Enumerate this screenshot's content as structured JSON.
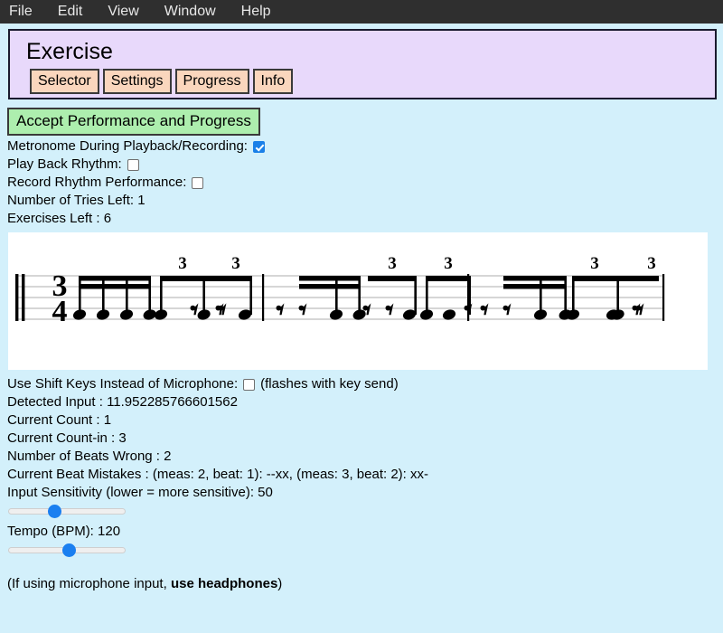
{
  "menubar": {
    "items": [
      {
        "label": "File"
      },
      {
        "label": "Edit"
      },
      {
        "label": "View"
      },
      {
        "label": "Window"
      },
      {
        "label": "Help"
      }
    ]
  },
  "header": {
    "title": "Exercise",
    "tabs": [
      {
        "label": "Selector"
      },
      {
        "label": "Settings"
      },
      {
        "label": "Progress"
      },
      {
        "label": "Info"
      }
    ]
  },
  "actions": {
    "accept_label": "Accept Performance and Progress"
  },
  "options": {
    "metronome_label": "Metronome During Playback/Recording:",
    "metronome_checked": true,
    "playback_label": "Play Back Rhythm:",
    "playback_checked": false,
    "record_label": "Record Rhythm Performance:",
    "record_checked": false,
    "shift_keys_label": "Use Shift Keys Instead of Microphone:",
    "shift_keys_checked": false,
    "shift_keys_hint": "(flashes with key send)"
  },
  "status": {
    "tries_left": "Number of Tries Left: 1",
    "exercises_left": "Exercises Left : 6",
    "detected_input": "Detected Input : 11.952285766601562",
    "current_count": "Current Count : 1",
    "current_count_in": "Current Count-in : 3",
    "beats_wrong": "Number of Beats Wrong : 2",
    "beat_mistakes": "Current Beat Mistakes : (meas: 2, beat: 1): --xx, (meas: 3, beat: 2): xx-"
  },
  "sliders": {
    "sensitivity_label": "Input Sensitivity (lower = more sensitive): 50",
    "sensitivity_value": 38,
    "tempo_label": "Tempo (BPM): 120",
    "tempo_value": 52
  },
  "footnote": {
    "prefix": "(If using microphone input, ",
    "bold": "use headphones",
    "suffix": ")"
  },
  "colors": {
    "page_bg": "#d3f0fb",
    "menubar_bg": "#2f2f2f",
    "header_panel_bg": "#e8d9fb",
    "tab_bg": "#fad6bd",
    "accept_bg": "#adeeae",
    "accent_blue": "#1a7ff0",
    "staff_line": "#c8c8c8",
    "note_black": "#000000"
  },
  "notation": {
    "time_signature": {
      "numerator": "3",
      "denominator": "4"
    },
    "triplet_marks": [
      "3",
      "3",
      "3",
      "3",
      "3",
      "3"
    ],
    "measures": [
      {
        "index": 1,
        "beats": [
          {
            "type": "sixteenth-group",
            "count": 4
          },
          {
            "type": "triplet",
            "notes": [
              "note",
              "note",
              "rest"
            ]
          },
          {
            "type": "triplet",
            "notes": [
              "rest",
              "rest",
              "note"
            ]
          }
        ]
      },
      {
        "index": 2,
        "beats": [
          {
            "type": "sixteenth-group",
            "count": 4,
            "notes": [
              "rest",
              "rest",
              "note",
              "note"
            ]
          },
          {
            "type": "triplet",
            "notes": [
              "rest",
              "rest",
              "note"
            ]
          },
          {
            "type": "triplet",
            "notes": [
              "note",
              "note",
              "rest"
            ]
          }
        ]
      },
      {
        "index": 3,
        "beats": [
          {
            "type": "sixteenth-group",
            "count": 4,
            "notes": [
              "rest",
              "rest",
              "note",
              "note"
            ]
          },
          {
            "type": "triplet",
            "notes": [
              "note",
              "note",
              "rest"
            ]
          },
          {
            "type": "triplet",
            "notes": [
              "note",
              "note",
              "rest"
            ]
          }
        ]
      }
    ]
  }
}
